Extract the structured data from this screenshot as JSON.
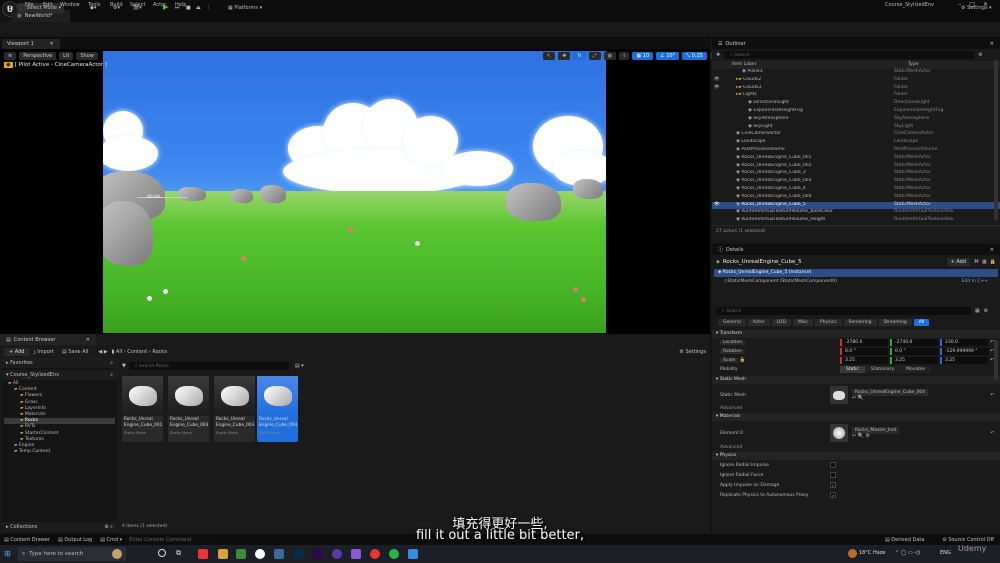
{
  "menubar": {
    "items": [
      "File",
      "Edit",
      "Window",
      "Tools",
      "Build",
      "Select",
      "Actor",
      "Help"
    ],
    "project": "Course_StylizedEnv",
    "world_tab": "NewWorld*",
    "logo": "U"
  },
  "toolbar": {
    "mode": "Select Mode",
    "platforms": "Platforms",
    "settings": "Settings"
  },
  "viewport": {
    "tab": "Viewport 1",
    "view": "Perspective",
    "lit": "Lit",
    "show": "Show",
    "pilot": "[ Pilot Active - CineCameraActor ]",
    "fov_label": "40.00",
    "snap_grid": "10",
    "snap_angle": "10°",
    "snap_scale": "0.25",
    "cam_speed": "4"
  },
  "outliner": {
    "title": "Outliner",
    "search_placeholder": "Search",
    "col_label": "Item Label",
    "col_type": "Type",
    "rows": [
      {
        "label": "Plane3",
        "type": "StaticMeshActor",
        "ind": 4
      },
      {
        "label": "Clouds2",
        "type": "Folder",
        "ind": 3
      },
      {
        "label": "Clouds3",
        "type": "Folder",
        "ind": 3
      },
      {
        "label": "Lights",
        "type": "Folder",
        "ind": 3
      },
      {
        "label": "DirectionalLight",
        "type": "DirectionalLight",
        "ind": 5
      },
      {
        "label": "ExponentialHeightFog",
        "type": "ExponentialHeightFog",
        "ind": 5
      },
      {
        "label": "SkyAtmosphere",
        "type": "SkyAtmosphere",
        "ind": 5
      },
      {
        "label": "SkyLight",
        "type": "SkyLight",
        "ind": 5
      },
      {
        "label": "CineCameraActor",
        "type": "CineCameraActor",
        "ind": 3
      },
      {
        "label": "Landscape",
        "type": "Landscape",
        "ind": 3
      },
      {
        "label": "PostProcessVolume",
        "type": "PostProcessVolume",
        "ind": 3
      },
      {
        "label": "Rocks_UnrealEngine_Cube_001",
        "type": "StaticMeshActor",
        "ind": 3
      },
      {
        "label": "Rocks_UnrealEngine_Cube_002",
        "type": "StaticMeshActor",
        "ind": 3
      },
      {
        "label": "Rocks_UnrealEngine_Cube_3",
        "type": "StaticMeshActor",
        "ind": 3
      },
      {
        "label": "Rocks_UnrealEngine_Cube_003",
        "type": "StaticMeshActor",
        "ind": 3
      },
      {
        "label": "Rocks_UnrealEngine_Cube_4",
        "type": "StaticMeshActor",
        "ind": 3
      },
      {
        "label": "Rocks_UnrealEngine_Cube_004",
        "type": "StaticMeshActor",
        "ind": 3
      },
      {
        "label": "Rocks_UnrealEngine_Cube_5",
        "type": "StaticMeshActor",
        "ind": 3,
        "sel": true
      },
      {
        "label": "RuntimeVirtualTextureVolume_BaseColor",
        "type": "RuntimeVirtualTextureVolu",
        "ind": 3
      },
      {
        "label": "RuntimeVirtualTextureVolume_Height",
        "type": "RuntimeVirtualTextureVolu",
        "ind": 3
      }
    ],
    "count": "27 actors (1 selected)"
  },
  "details": {
    "title": "Details",
    "actor": "Rocks_UnrealEngine_Cube_5",
    "add": "+ Add",
    "instance": "Rocks_UnrealEngine_Cube_5 (Instance)",
    "component": "StaticMeshComponent (StaticMeshComponent0)",
    "edit_cpp": "Edit in C++",
    "search_placeholder": "Search",
    "filters": [
      "General",
      "Actor",
      "LOD",
      "Misc",
      "Physics",
      "Rendering",
      "Streaming",
      "All"
    ],
    "transform": {
      "header": "Transform",
      "location_label": "Location",
      "rotation_label": "Rotation",
      "scale_label": "Scale",
      "mobility_label": "Mobility",
      "location": [
        "-2780.0",
        "-2740.0",
        "230.0"
      ],
      "rotation": [
        "0.0 °",
        "0.0 °",
        "-129.999999 °"
      ],
      "scale": [
        "3.25",
        "3.25",
        "3.25"
      ],
      "mobility": [
        "Static",
        "Stationary",
        "Movable"
      ]
    },
    "static_mesh": {
      "header": "Static Mesh",
      "label": "Static Mesh",
      "value": "Rocks_UnrealEngine_Cube_004",
      "advanced": "Advanced"
    },
    "materials": {
      "header": "Materials",
      "label": "Element 0",
      "value": "Rocks_Master_Inst",
      "advanced": "Advanced"
    },
    "physics": {
      "header": "Physics",
      "props": [
        "Ignore Radial Impulse",
        "Ignore Radial Force",
        "Apply Impulse on Damage",
        "Replicate Physics to Autonomous Proxy"
      ]
    }
  },
  "content_browser": {
    "title": "Content Browser",
    "add": "+ Add",
    "import": "Import",
    "save_all": "Save All",
    "path": [
      "All",
      "Content",
      "Rocks"
    ],
    "settings": "Settings",
    "search_placeholder": "Search Rocks",
    "favorites": "Favorites",
    "root": "Course_StylizedEnv",
    "tree": [
      {
        "t": "All",
        "i": 0
      },
      {
        "t": "Content",
        "i": 1
      },
      {
        "t": "Flowers",
        "i": 2
      },
      {
        "t": "Grass",
        "i": 2
      },
      {
        "t": "LayerInfo",
        "i": 2
      },
      {
        "t": "Materials",
        "i": 2
      },
      {
        "t": "Rocks",
        "i": 2,
        "sel": true
      },
      {
        "t": "RVTs",
        "i": 2
      },
      {
        "t": "StarterContent",
        "i": 2
      },
      {
        "t": "Textures",
        "i": 2
      },
      {
        "t": "Engine",
        "i": 1
      },
      {
        "t": "Temp Content",
        "i": 1
      }
    ],
    "assets": [
      {
        "name": "Rocks_Unreal Engine_Cube_001",
        "type": "Static Mesh"
      },
      {
        "name": "Rocks_Unreal Engine_Cube_003",
        "type": "Static Mesh"
      },
      {
        "name": "Rocks_Unreal Engine_Cube_003",
        "type": "Static Mesh"
      },
      {
        "name": "Rocks_Unreal Engine_Cube_004",
        "type": "Static Mesh",
        "sel": true
      }
    ],
    "collections": "Collections",
    "count": "4 items (1 selected)"
  },
  "statusbar": {
    "drawer": "Content Drawer",
    "output": "Output Log",
    "cmd": "Cmd",
    "cmd_placeholder": "Enter Console Command",
    "derived": "Derived Data",
    "source": "Source Control Off"
  },
  "subtitle": {
    "cn": "填充得更好一些,",
    "en": "fill it out a little bit better,"
  },
  "taskbar": {
    "search": "Type here to search",
    "weather": "18°C Haze",
    "lang": "ENG",
    "watermark": "Udemy"
  }
}
